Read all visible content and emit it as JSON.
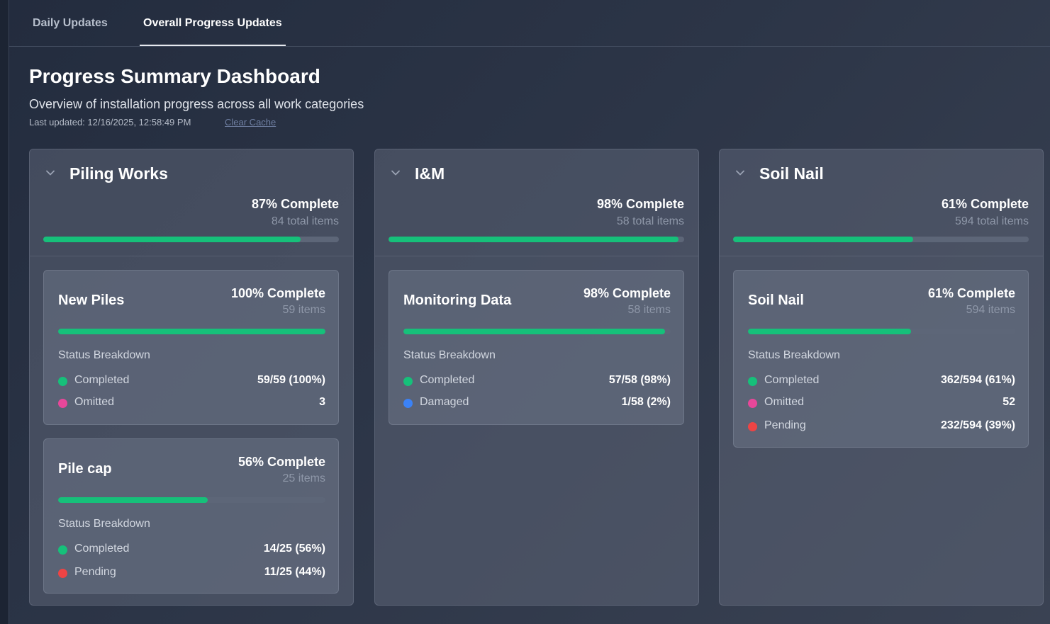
{
  "tabs": [
    {
      "label": "Daily Updates"
    },
    {
      "label": "Overall Progress Updates"
    }
  ],
  "header": {
    "title": "Progress Summary Dashboard",
    "subtitle": "Overview of installation progress across all work categories",
    "last_updated": "Last updated: 12/16/2025, 12:58:49 PM",
    "clear_cache": "Clear Cache"
  },
  "colors": {
    "completed": "#16c07a",
    "omitted": "#e8479a",
    "pending": "#ee4444",
    "damaged": "#3b82f6"
  },
  "categories": [
    {
      "title": "Piling Works",
      "percent_text": "87% Complete",
      "percent": 87,
      "total_text": "84 total items",
      "subs": [
        {
          "title": "New Piles",
          "percent_text": "100% Complete",
          "percent": 100,
          "items_text": "59 items",
          "breakdown_label": "Status Breakdown",
          "rows": [
            {
              "label": "Completed",
              "value": "59/59 (100%)",
              "color": "#16c07a"
            },
            {
              "label": "Omitted",
              "value": "3",
              "color": "#e8479a"
            }
          ]
        },
        {
          "title": "Pile cap",
          "percent_text": "56% Complete",
          "percent": 56,
          "items_text": "25 items",
          "breakdown_label": "Status Breakdown",
          "rows": [
            {
              "label": "Completed",
              "value": "14/25 (56%)",
              "color": "#16c07a"
            },
            {
              "label": "Pending",
              "value": "11/25 (44%)",
              "color": "#ee4444"
            }
          ]
        }
      ]
    },
    {
      "title": "I&M",
      "percent_text": "98% Complete",
      "percent": 98,
      "total_text": "58 total items",
      "subs": [
        {
          "title": "Monitoring Data",
          "percent_text": "98% Complete",
          "percent": 98,
          "items_text": "58 items",
          "breakdown_label": "Status Breakdown",
          "rows": [
            {
              "label": "Completed",
              "value": "57/58 (98%)",
              "color": "#16c07a"
            },
            {
              "label": "Damaged",
              "value": "1/58 (2%)",
              "color": "#3b82f6"
            }
          ]
        }
      ]
    },
    {
      "title": "Soil Nail",
      "percent_text": "61% Complete",
      "percent": 61,
      "total_text": "594 total items",
      "subs": [
        {
          "title": "Soil Nail",
          "percent_text": "61% Complete",
          "percent": 61,
          "items_text": "594 items",
          "breakdown_label": "Status Breakdown",
          "rows": [
            {
              "label": "Completed",
              "value": "362/594 (61%)",
              "color": "#16c07a"
            },
            {
              "label": "Omitted",
              "value": "52",
              "color": "#e8479a"
            },
            {
              "label": "Pending",
              "value": "232/594 (39%)",
              "color": "#ee4444"
            }
          ]
        }
      ]
    }
  ]
}
